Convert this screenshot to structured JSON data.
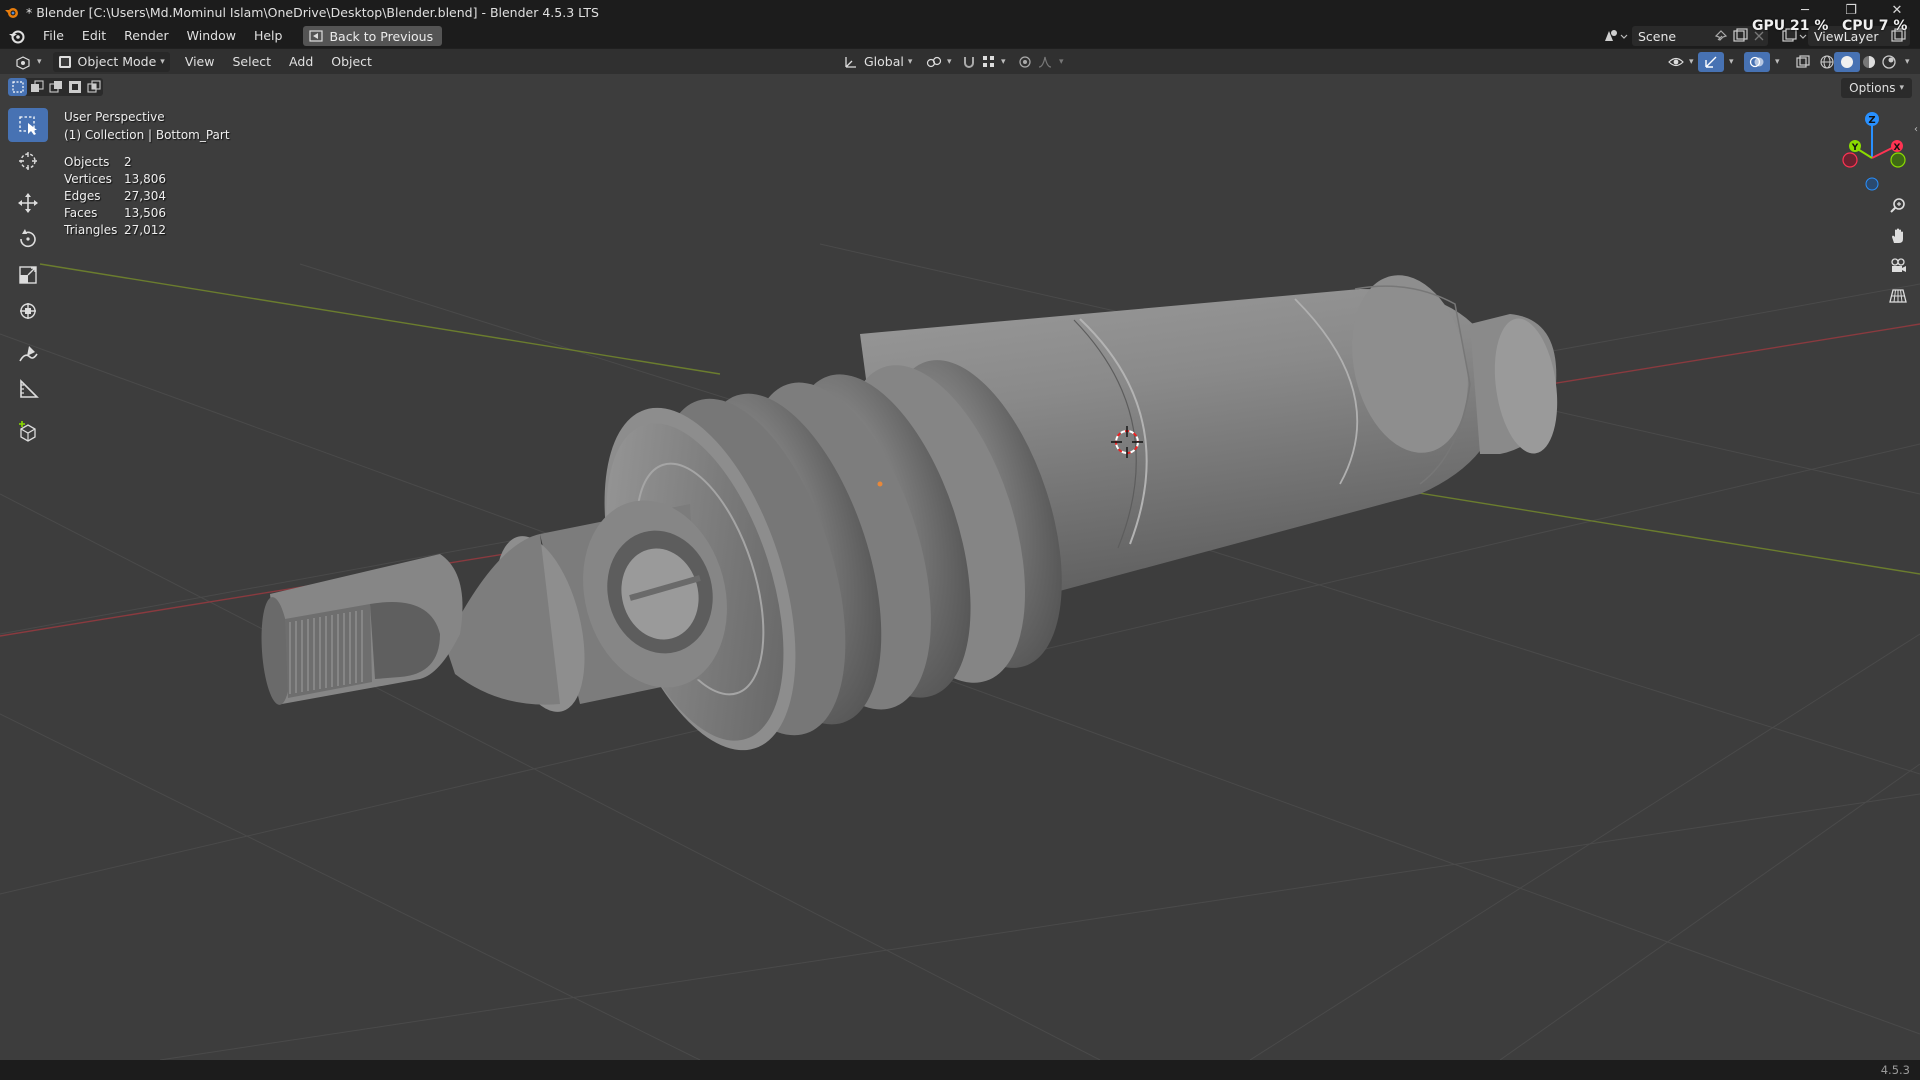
{
  "window": {
    "title": "* Blender [C:\\Users\\Md.Mominul Islam\\OneDrive\\Desktop\\Blender.blend] - Blender 4.5.3 LTS",
    "minimize": "─",
    "maximize": "❐",
    "close": "✕"
  },
  "menubar": {
    "items": [
      "File",
      "Edit",
      "Render",
      "Window",
      "Help"
    ],
    "back_label": "Back to Previous",
    "scene_label": "Scene",
    "viewlayer_label": "ViewLayer",
    "gpu": "GPU 21 %",
    "cpu": "CPU 7 %"
  },
  "header": {
    "mode": "Object Mode",
    "menus": [
      "View",
      "Select",
      "Add",
      "Object"
    ],
    "orientation": "Global",
    "options_label": "Options"
  },
  "overlay": {
    "perspective": "User Perspective",
    "collection": "(1) Collection | Bottom_Part"
  },
  "stats": [
    {
      "key": "Objects",
      "value": "2"
    },
    {
      "key": "Vertices",
      "value": "13,806"
    },
    {
      "key": "Edges",
      "value": "27,304"
    },
    {
      "key": "Faces",
      "value": "13,506"
    },
    {
      "key": "Triangles",
      "value": "27,012"
    }
  ],
  "gizmo": {
    "x": "X",
    "y": "Y",
    "z": "Z"
  },
  "statusbar": {
    "version": "4.5.3"
  },
  "colors": {
    "accent": "#4772b3",
    "x_axis": "#ff3352",
    "y_axis": "#8bdc00",
    "z_axis": "#2890ff"
  }
}
